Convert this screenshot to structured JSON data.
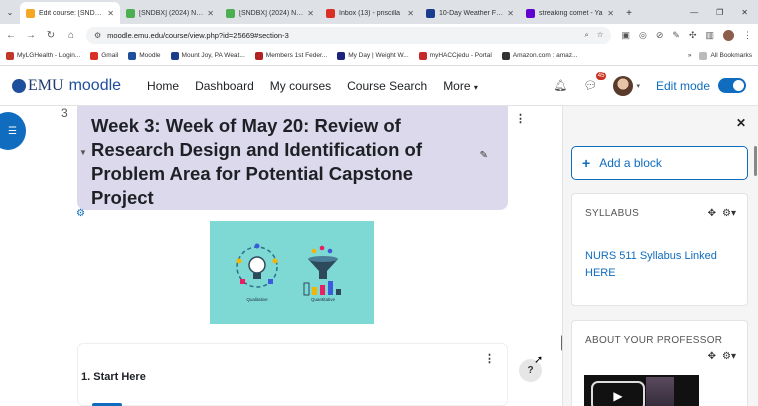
{
  "browser": {
    "tabs": [
      {
        "title": "Edit course: [SNDBX",
        "active": true,
        "color": "#f5a623"
      },
      {
        "title": "[SNDBX] (2024) NUR",
        "active": false,
        "color": "#4caf50"
      },
      {
        "title": "[SNDBX] (2024) NUR",
        "active": false,
        "color": "#4caf50"
      },
      {
        "title": "Inbox (13) - priscilla",
        "active": false,
        "color": "#d93025"
      },
      {
        "title": "10-Day Weather Fore",
        "active": false,
        "color": "#1a3c8c"
      },
      {
        "title": "streaking comet - Ya",
        "active": false,
        "color": "#6001d2"
      }
    ],
    "url": "moodle.emu.edu/course/view.php?id=25669#section-3",
    "bookmarks": [
      {
        "label": "MyLGHealth - Login...",
        "color": "#c0392b"
      },
      {
        "label": "Gmail",
        "color": "#d93025"
      },
      {
        "label": "Moodle",
        "color": "#1e4f9c"
      },
      {
        "label": "Mount Joy, PA Weat...",
        "color": "#1a3c8c"
      },
      {
        "label": "Members 1st Feder...",
        "color": "#b22222"
      },
      {
        "label": "My Day | Weight W...",
        "color": "#1a237e"
      },
      {
        "label": "myHACCjedu - Portal",
        "color": "#c62828"
      },
      {
        "label": "Amazon.com : amaz...",
        "color": "#333333"
      }
    ],
    "all_bookmarks": "All Bookmarks"
  },
  "navbar": {
    "brand_emu": "EMU",
    "brand_moodle": "moodle",
    "items": [
      "Home",
      "Dashboard",
      "My courses",
      "Course Search",
      "More"
    ],
    "message_count": "45",
    "edit_mode_label": "Edit mode"
  },
  "section": {
    "number": "3",
    "title": "Week 3: Week of May 20: Review of Research Design and Identification of Problem Area for Potential Capstone Project",
    "image_labels": [
      "Qualitative",
      "Quantitative"
    ]
  },
  "activity": {
    "name": "1. Start Here"
  },
  "drawer": {
    "add_block": "Add a block",
    "blocks": [
      {
        "title": "SYLLABUS",
        "link": "NURS 511 Syllabus Linked HERE"
      },
      {
        "title": "ABOUT YOUR PROFESSOR"
      }
    ]
  },
  "help_label": "?"
}
